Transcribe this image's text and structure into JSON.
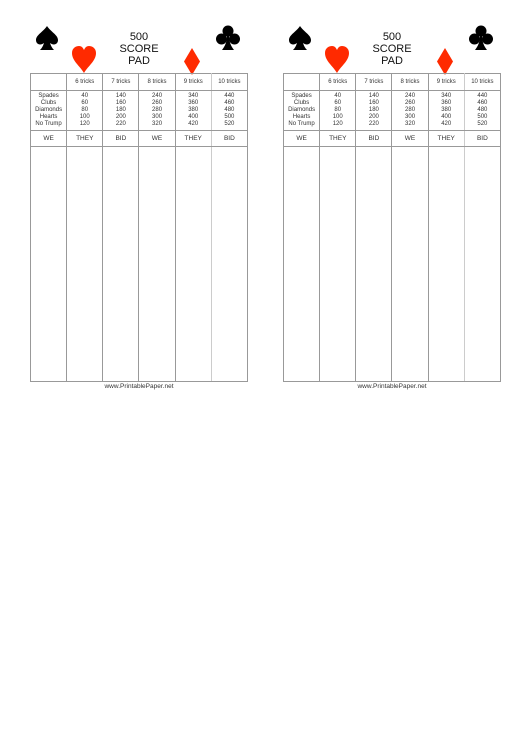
{
  "pads": [
    {
      "title": [
        "500",
        "SCORE",
        "PAD"
      ],
      "suits": {
        "top_left": "spade-icon",
        "top_right": "club-icon",
        "left": "heart-icon",
        "right": "diamond-icon"
      },
      "columns": [
        "6 tricks",
        "7 tricks",
        "8 tricks",
        "9 tricks",
        "10 tricks"
      ],
      "row_labels": [
        "Spades",
        "Clubs",
        "Diamonds",
        "Hearts",
        "No Trump"
      ],
      "values": [
        [
          "40",
          "60",
          "80",
          "100",
          "120"
        ],
        [
          "140",
          "160",
          "180",
          "200",
          "220"
        ],
        [
          "240",
          "260",
          "280",
          "300",
          "320"
        ],
        [
          "340",
          "360",
          "380",
          "400",
          "420"
        ],
        [
          "440",
          "460",
          "480",
          "500",
          "520"
        ]
      ],
      "score_headers": [
        "WE",
        "THEY",
        "BID",
        "WE",
        "THEY",
        "BID"
      ],
      "footer": "www.PrintablePaper.net"
    },
    {
      "title": [
        "500",
        "SCORE",
        "PAD"
      ],
      "suits": {
        "top_left": "spade-icon",
        "top_right": "club-icon",
        "left": "heart-icon",
        "right": "diamond-icon"
      },
      "columns": [
        "6 tricks",
        "7 tricks",
        "8 tricks",
        "9 tricks",
        "10 tricks"
      ],
      "row_labels": [
        "Spades",
        "Clubs",
        "Diamonds",
        "Hearts",
        "No Trump"
      ],
      "values": [
        [
          "40",
          "60",
          "80",
          "100",
          "120"
        ],
        [
          "140",
          "160",
          "180",
          "200",
          "220"
        ],
        [
          "240",
          "260",
          "280",
          "300",
          "320"
        ],
        [
          "340",
          "360",
          "380",
          "400",
          "420"
        ],
        [
          "440",
          "460",
          "480",
          "500",
          "520"
        ]
      ],
      "score_headers": [
        "WE",
        "THEY",
        "BID",
        "WE",
        "THEY",
        "BID"
      ],
      "footer": "www.PrintablePaper.net"
    }
  ],
  "colors": {
    "black_suit": "#000000",
    "red_suit": "#ff2a00"
  }
}
